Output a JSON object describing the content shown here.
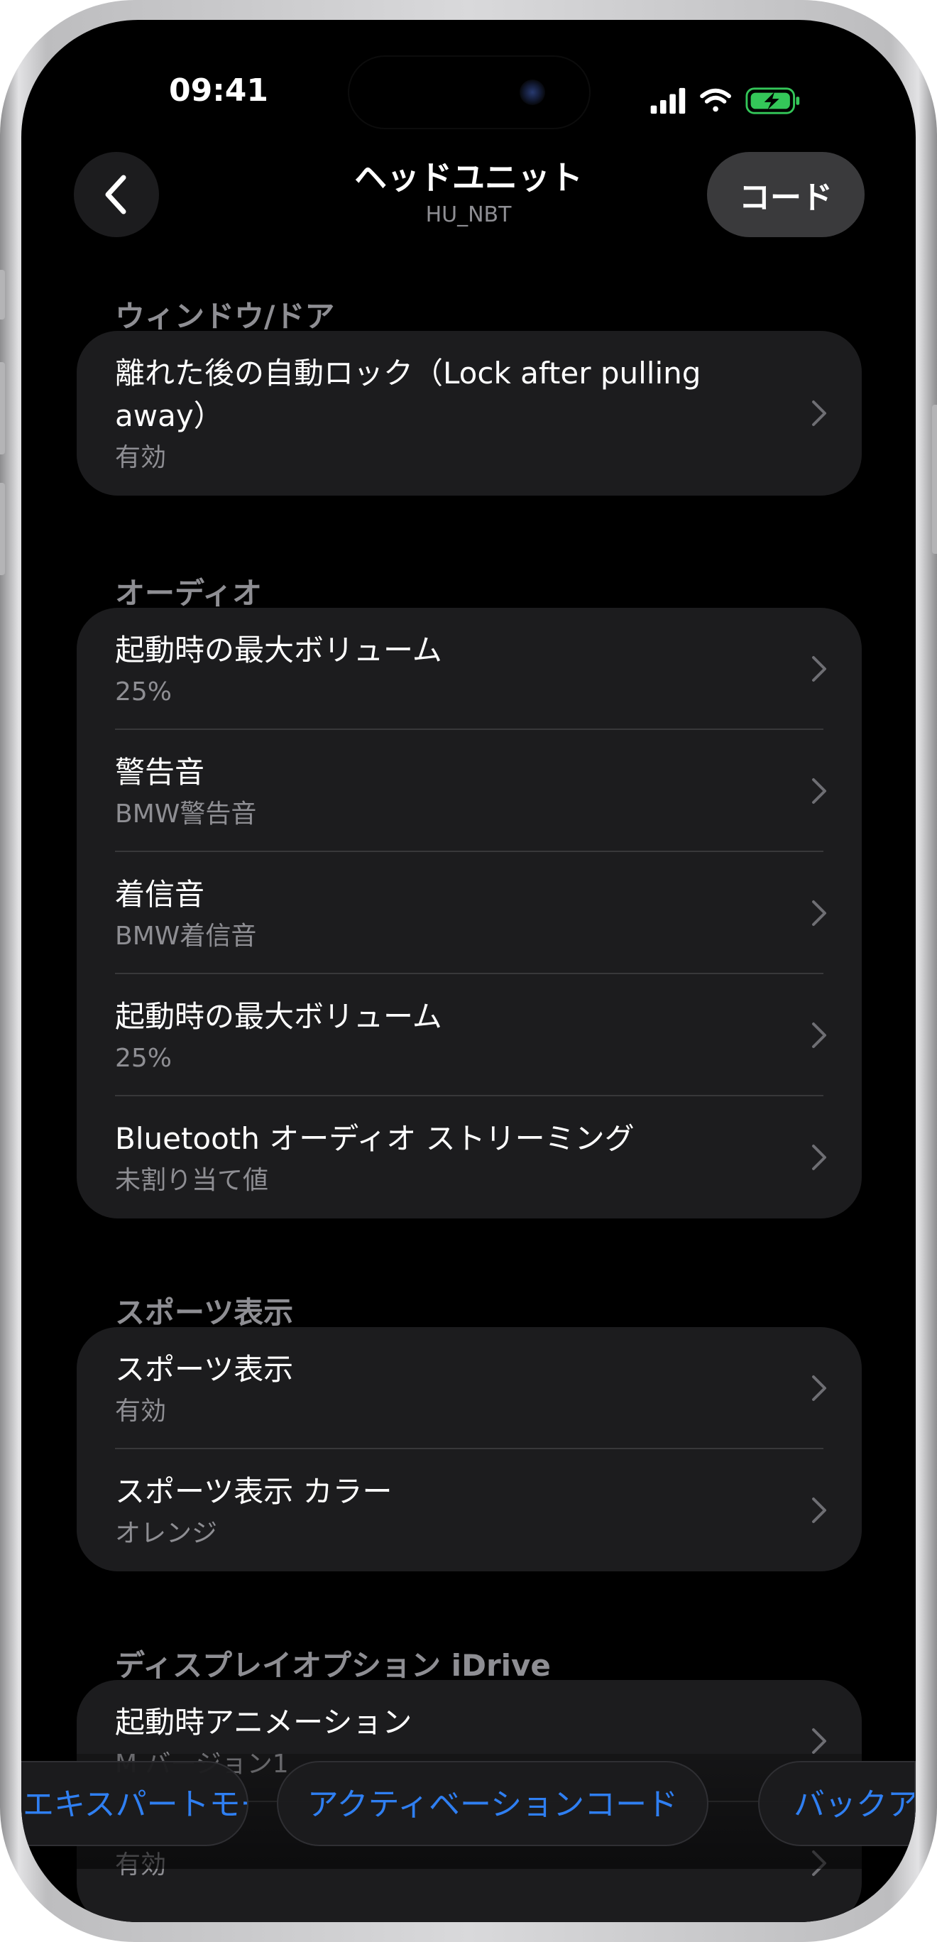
{
  "status_bar": {
    "time": "09:41",
    "signal_icon": "cellular-signal-icon",
    "wifi_icon": "wifi-icon",
    "battery_icon": "battery-charging-icon",
    "battery_color": "#34c759"
  },
  "nav": {
    "back_icon": "chevron-left-icon",
    "title": "ヘッドユニット",
    "subtitle": "HU_NBT",
    "code_button": "コード"
  },
  "sections": [
    {
      "header": "ウィンドウ/ドア",
      "rows": [
        {
          "title": "離れた後の自動ロック（Lock after pulling away）",
          "value": "有効"
        }
      ]
    },
    {
      "header": "オーディオ",
      "rows": [
        {
          "title": "起動時の最大ボリューム",
          "value": "25%"
        },
        {
          "title": "警告音",
          "value": "BMW警告音"
        },
        {
          "title": "着信音",
          "value": "BMW着信音"
        },
        {
          "title": "起動時の最大ボリューム",
          "value": "25%"
        },
        {
          "title": "Bluetooth オーディオ ストリーミング",
          "value": "未割り当て値"
        }
      ]
    },
    {
      "header": "スポーツ表示",
      "rows": [
        {
          "title": "スポーツ表示",
          "value": "有効"
        },
        {
          "title": "スポーツ表示 カラー",
          "value": "オレンジ"
        }
      ]
    },
    {
      "header": "ディスプレイオプション iDrive",
      "rows": [
        {
          "title": "起動時アニメーション",
          "value": "M バージョン1"
        },
        {
          "title": "",
          "value": "有効"
        }
      ]
    }
  ],
  "bottom_tabs": [
    {
      "label": "エキスパートモード"
    },
    {
      "label": "アクティベーションコード"
    },
    {
      "label": "バックアップ"
    }
  ],
  "colors": {
    "background": "#000000",
    "card": "#1c1c1e",
    "accent": "#2f7ff2",
    "secondary_text": "#8e8e93"
  }
}
